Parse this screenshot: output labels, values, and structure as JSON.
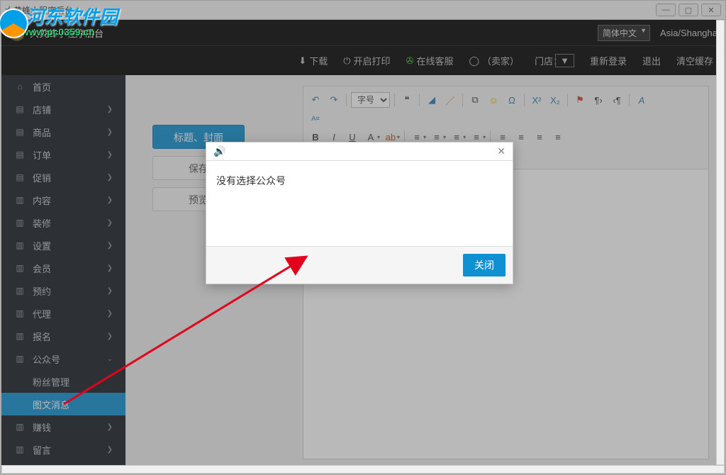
{
  "window": {
    "title": "大黄蜂小程序后台"
  },
  "watermark": {
    "line1": "河东软件园",
    "line2": "www.pc0359.cn"
  },
  "topbar1": {
    "logo_text": "大黄蜂小程序后台",
    "lang": "简体中文",
    "tz": "Asia/Shangha"
  },
  "topbar2": {
    "download": "下载",
    "print": "开启打印",
    "service": "在线客服",
    "seller": "（卖家）",
    "store": "门店：",
    "relogin": "重新登录",
    "logout": "退出",
    "clear": "清空缓存"
  },
  "sidebar": {
    "items": [
      {
        "icon": "⌂",
        "label": "首页",
        "arrow": ""
      },
      {
        "icon": "▤",
        "label": "店铺",
        "arrow": "❯"
      },
      {
        "icon": "▤",
        "label": "商品",
        "arrow": "❯"
      },
      {
        "icon": "▤",
        "label": "订单",
        "arrow": "❯"
      },
      {
        "icon": "▤",
        "label": "促销",
        "arrow": "❯"
      },
      {
        "icon": "▥",
        "label": "内容",
        "arrow": "❯"
      },
      {
        "icon": "▥",
        "label": "装修",
        "arrow": "❯"
      },
      {
        "icon": "▥",
        "label": "设置",
        "arrow": "❯"
      },
      {
        "icon": "▥",
        "label": "会员",
        "arrow": "❯"
      },
      {
        "icon": "▥",
        "label": "预约",
        "arrow": "❯"
      },
      {
        "icon": "▥",
        "label": "代理",
        "arrow": "❯"
      },
      {
        "icon": "▥",
        "label": "报名",
        "arrow": "❯"
      },
      {
        "icon": "▥",
        "label": "公众号",
        "arrow": "⌄"
      },
      {
        "icon": "▥",
        "label": "赚钱",
        "arrow": "❯"
      },
      {
        "icon": "▥",
        "label": "留言",
        "arrow": "❯"
      }
    ],
    "subs": [
      {
        "label": "粉丝管理",
        "active": false
      },
      {
        "label": "图文消息",
        "active": true
      }
    ]
  },
  "buttons": {
    "title_cover": "标题、封面",
    "save": "保存",
    "preview": "预览"
  },
  "editor": {
    "font_size_label": "字号"
  },
  "modal": {
    "message": "没有选择公众号",
    "close": "关闭"
  }
}
